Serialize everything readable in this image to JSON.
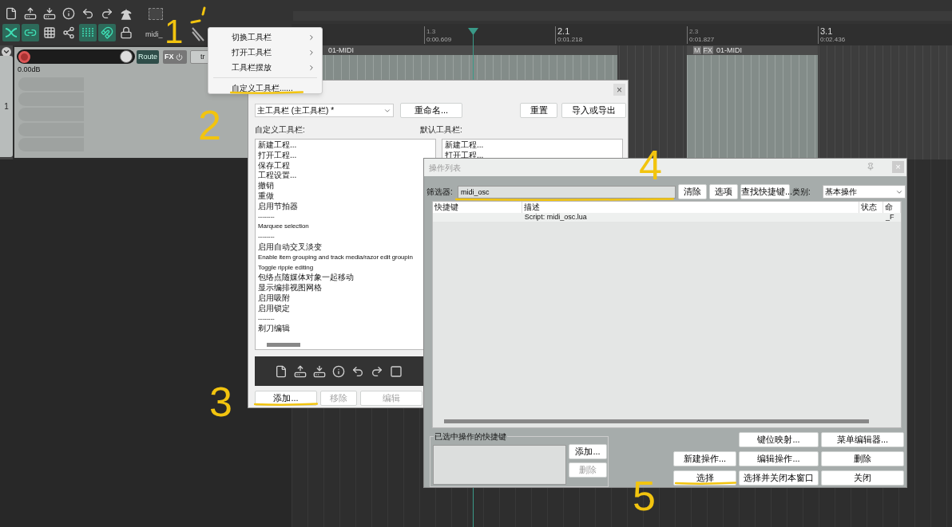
{
  "toolbar": {
    "label": "midi_"
  },
  "ruler": [
    {
      "bar": "1.3",
      "time": "0:00.609",
      "major": false
    },
    {
      "bar": "2.1",
      "time": "0:01.218",
      "major": true
    },
    {
      "bar": "2.3",
      "time": "0:01.827",
      "major": false
    },
    {
      "bar": "3.1",
      "time": "0:02.436",
      "major": true
    }
  ],
  "track": {
    "number": "1",
    "volume": "0.00dB",
    "route": "Route",
    "fx": "FX",
    "envelope": "tr"
  },
  "items": [
    {
      "name": "01-MIDI"
    },
    {
      "name": "01-MIDI",
      "badges": [
        "M",
        "FX"
      ]
    }
  ],
  "context_menu": {
    "items": [
      {
        "label": "切换工具栏",
        "submenu": true
      },
      {
        "label": "打开工具栏",
        "submenu": true
      },
      {
        "label": "工具栏摆放",
        "submenu": true
      },
      {
        "label": "自定义工具栏......",
        "submenu": false
      }
    ]
  },
  "customize_dialog": {
    "close": "×",
    "toolbar_select": "主工具栏 (主工具栏) *",
    "rename": "重命名...",
    "reset": "重置",
    "import_export": "导入或导出",
    "custom_label": "自定义工具栏:",
    "default_label": "默认工具栏:",
    "custom_items": [
      "新建工程...",
      "打开工程...",
      "保存工程",
      "工程设置...",
      "撤销",
      "重做",
      "启用节拍器",
      "--------",
      "Marquee selection",
      "--------",
      "启用自动交叉淡变",
      "Enable item grouping and track media/razor edit groupin",
      "Toggle ripple editing",
      "包络点随媒体对象一起移动",
      "显示编排视图网格",
      "启用吸附",
      "启用锁定",
      "--------",
      "剃刀编辑"
    ],
    "default_items": [
      "新建工程...",
      "打开工程..."
    ],
    "buttons": [
      {
        "label": "添加...",
        "disabled": false
      },
      {
        "label": "移除",
        "disabled": true
      },
      {
        "label": "编辑",
        "disabled": true
      }
    ]
  },
  "action_list": {
    "title": "操作列表",
    "close": "×",
    "filter_label": "筛选器:",
    "filter_value": "midi_osc",
    "clear": "清除",
    "options": "选项",
    "find_shortcut": "查找快捷键...",
    "category_label": "类别:",
    "category": "基本操作",
    "columns": [
      "快捷键",
      "描述",
      "状态",
      "命"
    ],
    "rows": [
      [
        "",
        "Script: midi_osc.lua",
        "",
        "_F"
      ]
    ],
    "shortcut_group": "已选中操作的快捷键",
    "shortcut_buttons": [
      {
        "label": "添加...",
        "disabled": false
      },
      {
        "label": "删除",
        "disabled": true
      }
    ],
    "buttons": [
      [
        "键位映射...",
        "菜单编辑器..."
      ],
      [
        "新建操作...",
        "编辑操作...",
        "删除"
      ],
      [
        "选择",
        "选择并关闭本窗口",
        "关闭"
      ]
    ]
  },
  "annotations": [
    "1",
    "2",
    "3",
    "4",
    "5"
  ]
}
